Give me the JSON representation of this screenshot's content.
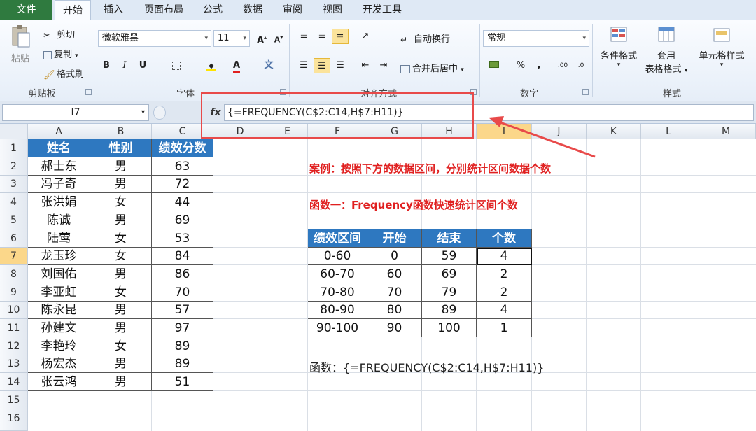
{
  "ribbon_tabs": [
    "文件",
    "开始",
    "插入",
    "页面布局",
    "公式",
    "数据",
    "审阅",
    "视图",
    "开发工具"
  ],
  "clipboard": {
    "paste": "粘贴",
    "cut": "剪切",
    "copy": "复制",
    "format_painter": "格式刷",
    "group": "剪贴板"
  },
  "font": {
    "name": "微软雅黑",
    "size": "11",
    "bold": "B",
    "italic": "I",
    "underline": "U",
    "group": "字体"
  },
  "alignment": {
    "wrap": "自动换行",
    "merge": "合并后居中",
    "group": "对齐方式"
  },
  "number": {
    "format": "常规",
    "percent": "%",
    "comma": ",",
    "group": "数字"
  },
  "styles": {
    "conditional": "条件格式",
    "table_line1": "套用",
    "table_line2": "表格格式",
    "cell_styles": "单元格样式",
    "group": "样式"
  },
  "formula_bar": {
    "name_box": "I7",
    "fx": "fx",
    "formula": "{=FREQUENCY(C$2:C14,H$7:H11)}"
  },
  "columns": [
    "A",
    "B",
    "C",
    "D",
    "E",
    "F",
    "G",
    "H",
    "I",
    "J",
    "K",
    "L",
    "M"
  ],
  "rows": [
    "1",
    "2",
    "3",
    "4",
    "5",
    "6",
    "7",
    "8",
    "9",
    "10",
    "11",
    "12",
    "13",
    "14",
    "15",
    "16"
  ],
  "data_table": {
    "headers": [
      "姓名",
      "性别",
      "绩效分数"
    ],
    "rows": [
      [
        "郝士东",
        "男",
        "63"
      ],
      [
        "冯子奇",
        "男",
        "72"
      ],
      [
        "张洪娟",
        "女",
        "44"
      ],
      [
        "陈诚",
        "男",
        "69"
      ],
      [
        "陆莺",
        "女",
        "53"
      ],
      [
        "龙玉珍",
        "女",
        "84"
      ],
      [
        "刘国佑",
        "男",
        "86"
      ],
      [
        "李亚虹",
        "女",
        "70"
      ],
      [
        "陈永昆",
        "男",
        "57"
      ],
      [
        "孙建文",
        "男",
        "97"
      ],
      [
        "李艳玲",
        "女",
        "89"
      ],
      [
        "杨宏杰",
        "男",
        "89"
      ],
      [
        "张云鸿",
        "男",
        "51"
      ]
    ]
  },
  "freq_table": {
    "headers": [
      "绩效区间",
      "开始",
      "结束",
      "个数"
    ],
    "rows": [
      [
        "0-60",
        "0",
        "59",
        "4"
      ],
      [
        "60-70",
        "60",
        "69",
        "2"
      ],
      [
        "70-80",
        "70",
        "79",
        "2"
      ],
      [
        "80-90",
        "80",
        "89",
        "4"
      ],
      [
        "90-100",
        "90",
        "100",
        "1"
      ]
    ]
  },
  "notes": {
    "case": "案例：按照下方的数据区间，分别统计区间数据个数",
    "func1": "函数一：Frequency函数快速统计区间个数",
    "formula": "函数：{=FREQUENCY(C$2:C14,H$7:H11)}"
  },
  "colors": {
    "header_blue": "#2e78c0",
    "annotation_red": "#e02020",
    "file_tab_green": "#2f7a3f"
  }
}
